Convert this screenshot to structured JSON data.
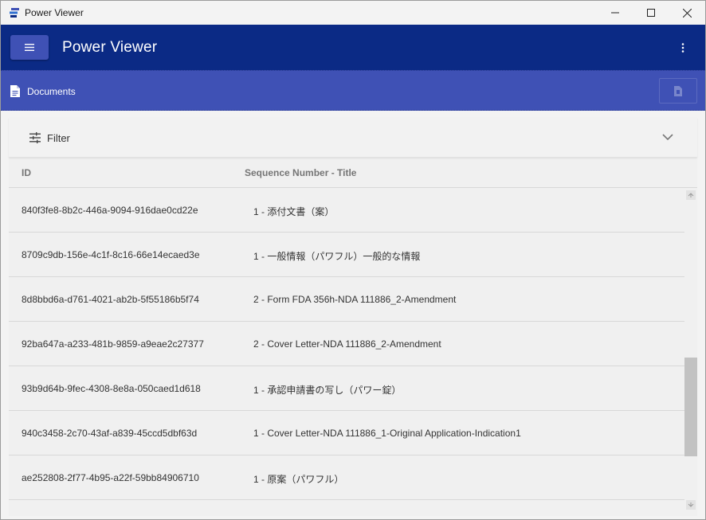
{
  "window": {
    "title": "Power Viewer"
  },
  "appbar": {
    "title": "Power Viewer",
    "menu_icon": "hamburger-icon",
    "more_icon": "more-vertical-icon"
  },
  "section": {
    "title": "Documents",
    "icon": "document-icon",
    "export_icon": "file-export-icon"
  },
  "filter": {
    "label": "Filter",
    "icon": "sliders-icon",
    "toggle_icon": "chevron-down-icon"
  },
  "table": {
    "columns": {
      "id": "ID",
      "title": "Sequence Number - Title"
    },
    "rows": [
      {
        "id": "840f3fe8-8b2c-446a-9094-916dae0cd22e",
        "title": "1 - 添付文書（案）"
      },
      {
        "id": "8709c9db-156e-4c1f-8c16-66e14ecaed3e",
        "title": "1 - 一般情報（パワフル）一般的な情報"
      },
      {
        "id": "8d8bbd6a-d761-4021-ab2b-5f55186b5f74",
        "title": "2 - Form FDA 356h-NDA 111886_2-Amendment"
      },
      {
        "id": "92ba647a-a233-481b-9859-a9eae2c27377",
        "title": "2 - Cover Letter-NDA 111886_2-Amendment"
      },
      {
        "id": "93b9d64b-9fec-4308-8e8a-050caed1d618",
        "title": "1 - 承認申請書の写し（パワー錠）"
      },
      {
        "id": "940c3458-2c70-43af-a839-45ccd5dbf63d",
        "title": "1 - Cover Letter-NDA 111886_1-Original Application-Indication1"
      },
      {
        "id": "ae252808-2f77-4b95-a22f-59bb84906710",
        "title": "1 - 原案（パワフル）"
      }
    ]
  },
  "colors": {
    "appbar": "#0b2a85",
    "section": "#3f51b5",
    "menu_button": "#3f51b5"
  }
}
